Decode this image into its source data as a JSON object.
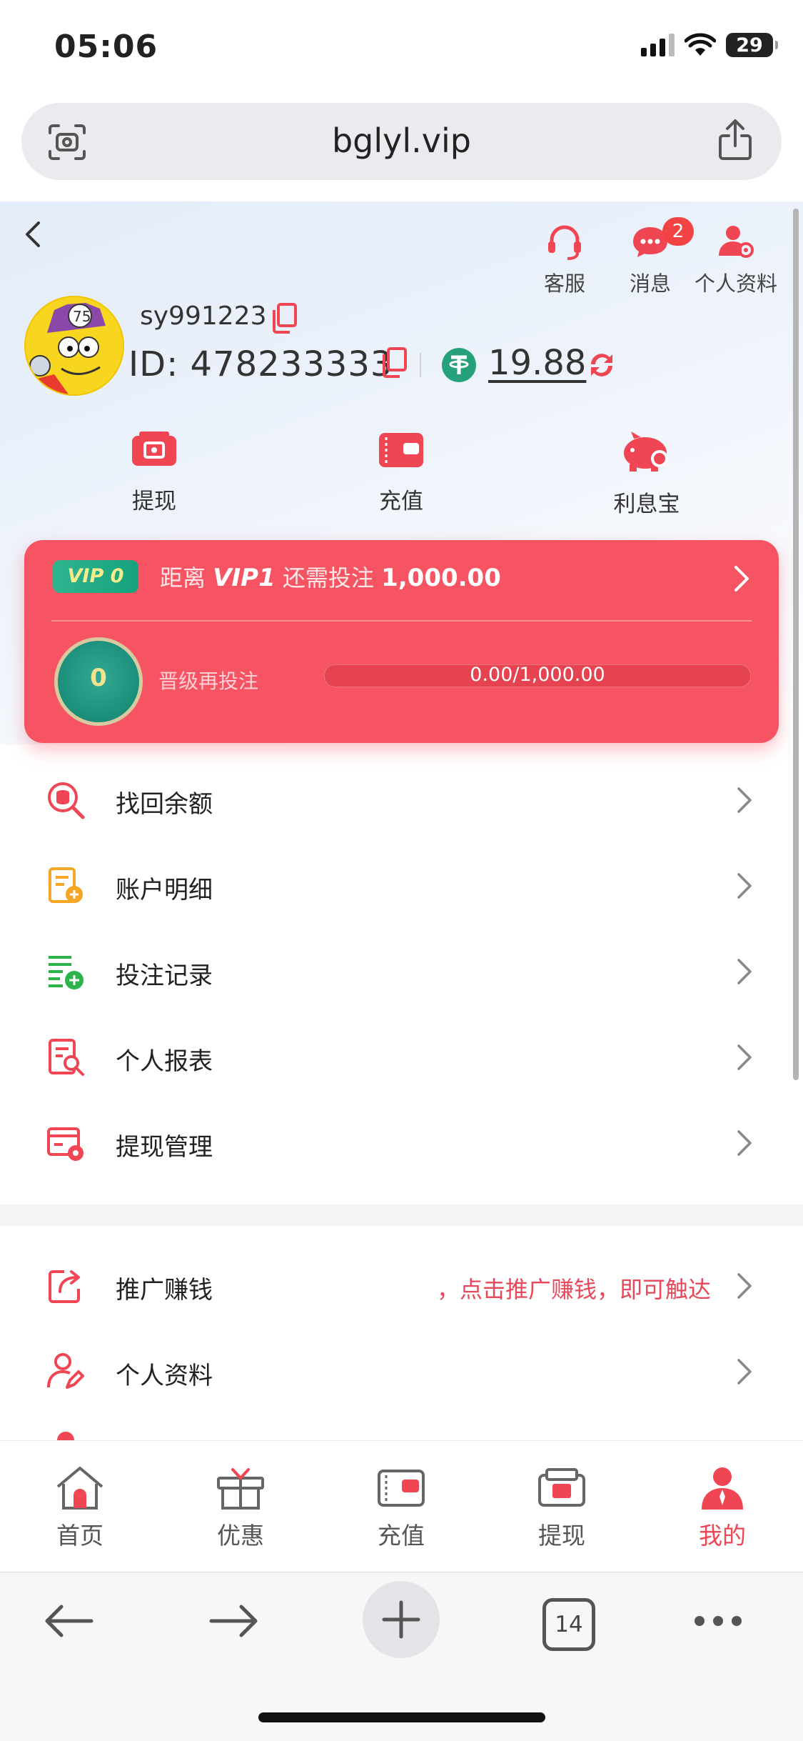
{
  "status_bar": {
    "time": "05:06",
    "battery": "29"
  },
  "browser": {
    "url": "bglyl.vip",
    "tab_count": "14"
  },
  "header": {
    "actions": [
      {
        "label": "客服",
        "icon": "headset-icon"
      },
      {
        "label": "消息",
        "icon": "chat-icon",
        "badge": "2"
      },
      {
        "label": "个人资料",
        "icon": "user-settings-icon"
      }
    ]
  },
  "profile": {
    "username": "sy991223",
    "id_label": "ID: 478233333",
    "balance": "19.88"
  },
  "quick_actions": [
    {
      "label": "提现",
      "icon": "withdraw-icon"
    },
    {
      "label": "充值",
      "icon": "wallet-icon"
    },
    {
      "label": "利息宝",
      "icon": "piggy-bank-icon"
    }
  ],
  "vip": {
    "tag": "VIP 0",
    "prefix": "距离",
    "target": "VIP1",
    "mid": "还需投注",
    "amount": "1,000.00",
    "level": "0",
    "sub_label": "晋级再投注",
    "progress_text": "0.00/1,000.00",
    "progress_fraction": 0
  },
  "menu": [
    {
      "label": "找回余额",
      "icon": "search-coins-icon"
    },
    {
      "label": "账户明细",
      "icon": "account-detail-icon"
    },
    {
      "label": "投注记录",
      "icon": "bet-record-icon"
    },
    {
      "label": "个人报表",
      "icon": "report-icon"
    },
    {
      "label": "提现管理",
      "icon": "withdraw-manage-icon"
    }
  ],
  "menu2": [
    {
      "label": "推广赚钱",
      "icon": "share-icon",
      "promo": "，点击推广赚钱，即可触达"
    },
    {
      "label": "个人资料",
      "icon": "user-edit-icon"
    }
  ],
  "tabbar": [
    {
      "label": "首页",
      "icon": "home-icon"
    },
    {
      "label": "优惠",
      "icon": "gift-icon"
    },
    {
      "label": "充值",
      "icon": "wallet-icon"
    },
    {
      "label": "提现",
      "icon": "withdraw-icon"
    },
    {
      "label": "我的",
      "icon": "user-icon",
      "active": true
    }
  ],
  "colors": {
    "accent": "#f04654",
    "vip_card": "#f75463",
    "usdt": "#26a17b"
  }
}
